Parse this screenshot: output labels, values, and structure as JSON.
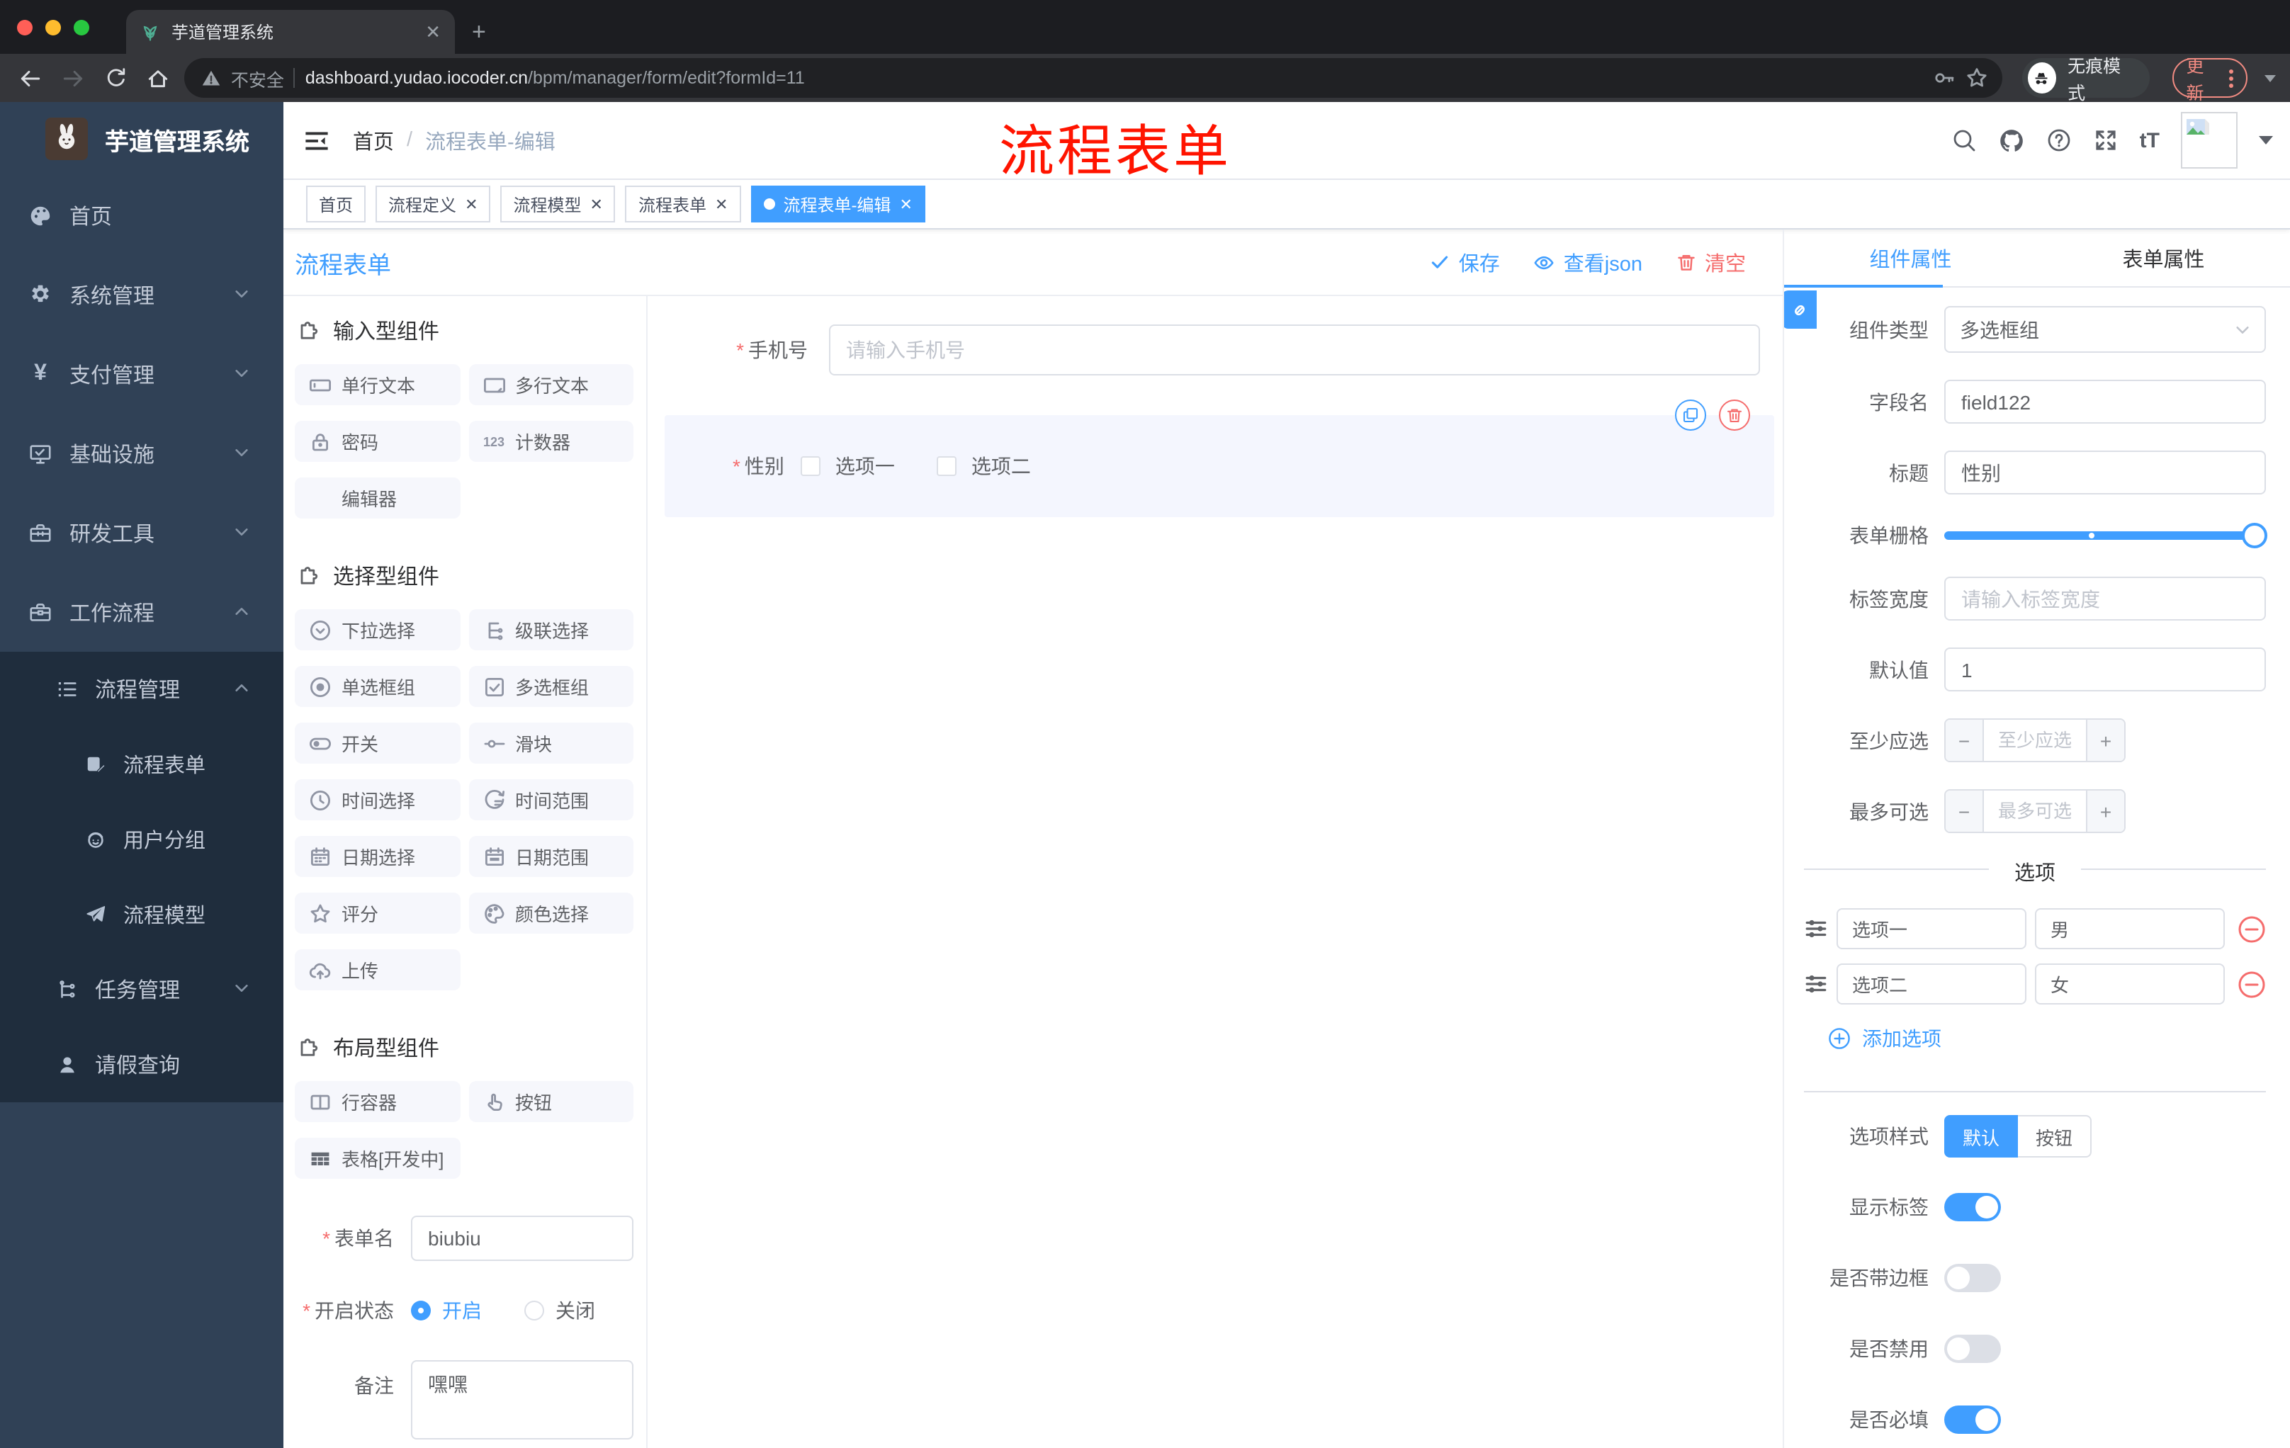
{
  "browser": {
    "tab_title": "芋道管理系统",
    "close_tab": "✕",
    "new_tab": "+",
    "security_label": "不安全",
    "url_host": "dashboard.yudao.iocoder.cn",
    "url_path": "/bpm/manager/form/edit?formId=11",
    "incognito_label": "无痕模式",
    "update_label": "更新"
  },
  "sidebar": {
    "logo_title": "芋道管理系统",
    "items": [
      {
        "label": "首页"
      },
      {
        "label": "系统管理"
      },
      {
        "label": "支付管理"
      },
      {
        "label": "基础设施"
      },
      {
        "label": "研发工具"
      },
      {
        "label": "工作流程"
      },
      {
        "label": "流程管理"
      },
      {
        "label": "流程表单"
      },
      {
        "label": "用户分组"
      },
      {
        "label": "流程模型"
      },
      {
        "label": "任务管理"
      },
      {
        "label": "请假查询"
      }
    ]
  },
  "navbar": {
    "breadcrumb_home": "首页",
    "breadcrumb_sep": "/",
    "breadcrumb_current": "流程表单-编辑",
    "annotation": "流程表单"
  },
  "tags": [
    {
      "label": "首页"
    },
    {
      "label": "流程定义"
    },
    {
      "label": "流程模型"
    },
    {
      "label": "流程表单"
    },
    {
      "label": "流程表单-编辑"
    }
  ],
  "tag_close": "✕",
  "workhead": {
    "title": "流程表单",
    "save": "保存",
    "view_json": "查看json",
    "clear": "清空"
  },
  "components": {
    "group_input": "输入型组件",
    "group_select": "选择型组件",
    "group_layout": "布局型组件",
    "input_items": [
      "单行文本",
      "多行文本",
      "密码",
      "计数器",
      "编辑器"
    ],
    "select_items": [
      "下拉选择",
      "级联选择",
      "单选框组",
      "多选框组",
      "开关",
      "滑块",
      "时间选择",
      "时间范围",
      "日期选择",
      "日期范围",
      "评分",
      "颜色选择",
      "上传"
    ],
    "layout_items": [
      "行容器",
      "按钮",
      "表格[开发中]"
    ]
  },
  "meta": {
    "required_mark": "*",
    "form_name_label": "表单名",
    "form_name_value": "biubiu",
    "status_label": "开启状态",
    "status_on": "开启",
    "status_off": "关闭",
    "remark_label": "备注",
    "remark_value": "嘿嘿"
  },
  "canvas": {
    "phone_label": "手机号",
    "phone_placeholder": "请输入手机号",
    "gender_label": "性别",
    "gender_opt1": "选项一",
    "gender_opt2": "选项二"
  },
  "props": {
    "tab_component": "组件属性",
    "tab_form": "表单属性",
    "type_label": "组件类型",
    "type_value": "多选框组",
    "field_label": "字段名",
    "field_value": "field122",
    "title_label": "标题",
    "title_value": "性别",
    "grid_label": "表单栅格",
    "label_width_label": "标签宽度",
    "label_width_placeholder": "请输入标签宽度",
    "default_label": "默认值",
    "default_value": "1",
    "min_label": "至少应选",
    "min_placeholder": "至少应选",
    "max_label": "最多可选",
    "max_placeholder": "最多可选",
    "minus_sign": "−",
    "plus_sign": "+",
    "options_title": "选项",
    "options": [
      {
        "label": "选项一",
        "value": "男"
      },
      {
        "label": "选项二",
        "value": "女"
      }
    ],
    "add_option": "添加选项",
    "style_label": "选项样式",
    "style_default": "默认",
    "style_button": "按钮",
    "show_label_label": "显示标签",
    "bordered_label": "是否带边框",
    "disabled_label": "是否禁用",
    "required_label": "是否必填"
  },
  "icons": {
    "counter": "123",
    "font_size": "tT",
    "yen": "¥"
  }
}
